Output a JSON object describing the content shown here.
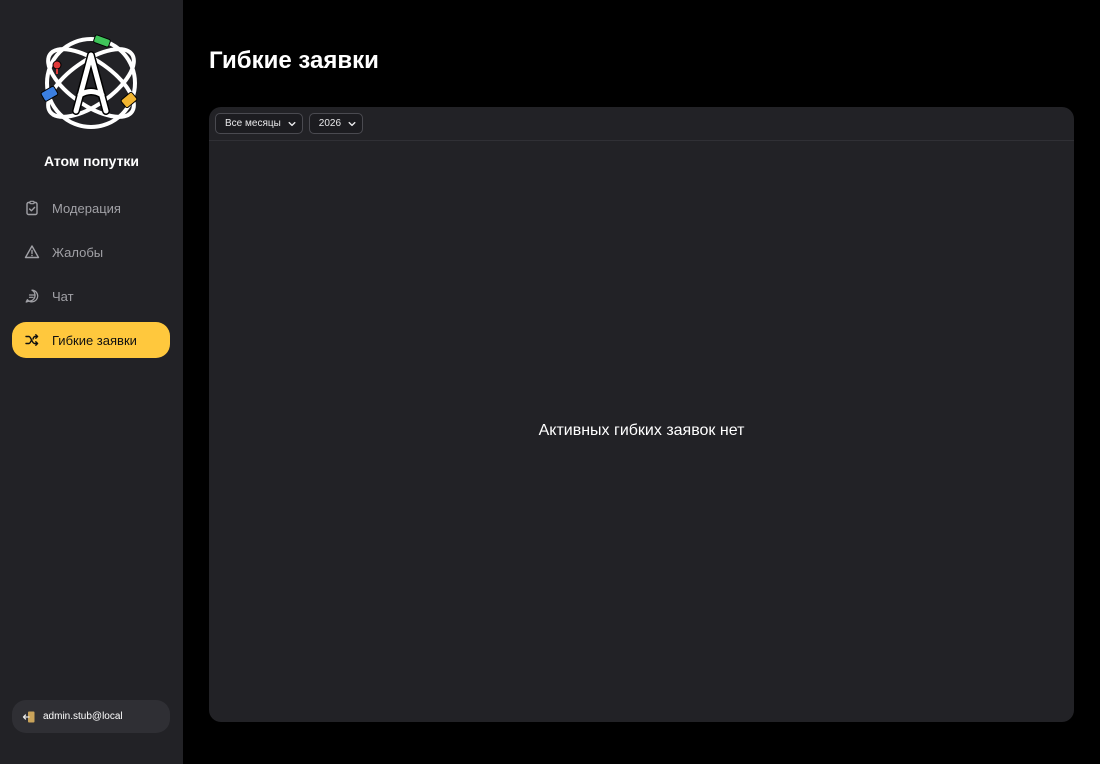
{
  "brand": {
    "name": "Атом попутки"
  },
  "nav": [
    {
      "label": "Модерация",
      "icon": "clipboard-check-icon",
      "active": false
    },
    {
      "label": "Жалобы",
      "icon": "alert-triangle-icon",
      "active": false
    },
    {
      "label": "Чат",
      "icon": "chat-icon",
      "active": false
    },
    {
      "label": "Гибкие заявки",
      "icon": "shuffle-icon",
      "active": true
    }
  ],
  "user": {
    "email": "admin.stub@local",
    "icon": "logout-icon"
  },
  "page": {
    "title": "Гибкие заявки"
  },
  "filters": {
    "month": {
      "selected": "Все месяцы"
    },
    "year": {
      "selected": "2026"
    }
  },
  "empty_state": {
    "text": "Активных гибких заявок нет"
  },
  "colors": {
    "accent": "#ffc83d",
    "sidebar_bg": "#222226",
    "panel_bg": "#222226",
    "page_bg": "#000000"
  }
}
